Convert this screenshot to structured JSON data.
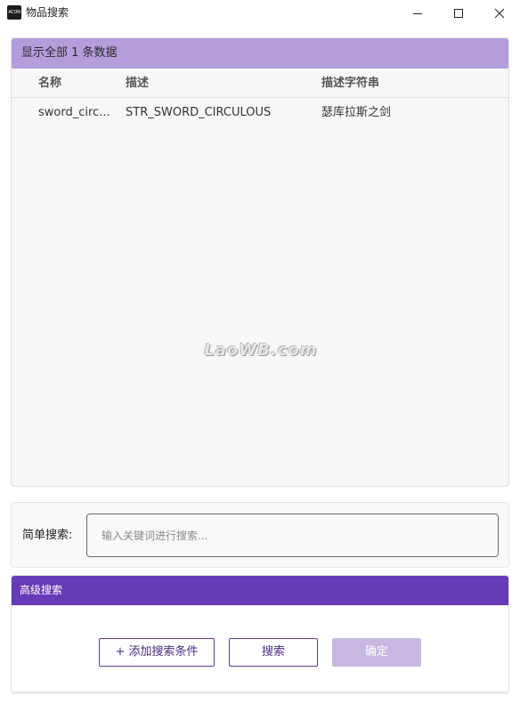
{
  "window": {
    "title": "物品搜索",
    "icon_label": "ACON",
    "controls": {
      "minimize": "minimize-icon",
      "maximize": "maximize-icon",
      "close": "close-icon"
    }
  },
  "results": {
    "header": "显示全部 1 条数据",
    "columns": [
      "名称",
      "描述",
      "描述字符串"
    ],
    "rows": [
      [
        "sword_circ...",
        "STR_SWORD_CIRCULOUS",
        "瑟库拉斯之剑"
      ]
    ],
    "watermark": "LaoWB.com"
  },
  "simple_search": {
    "label": "简单搜索:",
    "placeholder": "输入关键词进行搜索...",
    "value": ""
  },
  "advanced_search": {
    "header": "高级搜索",
    "add_condition_label": "+ 添加搜索条件",
    "search_label": "搜索",
    "confirm_label": "确定"
  },
  "colors": {
    "results_header": "#b39ddb",
    "advanced_header": "#673ab7",
    "confirm_disabled": "#c6b8e2"
  }
}
